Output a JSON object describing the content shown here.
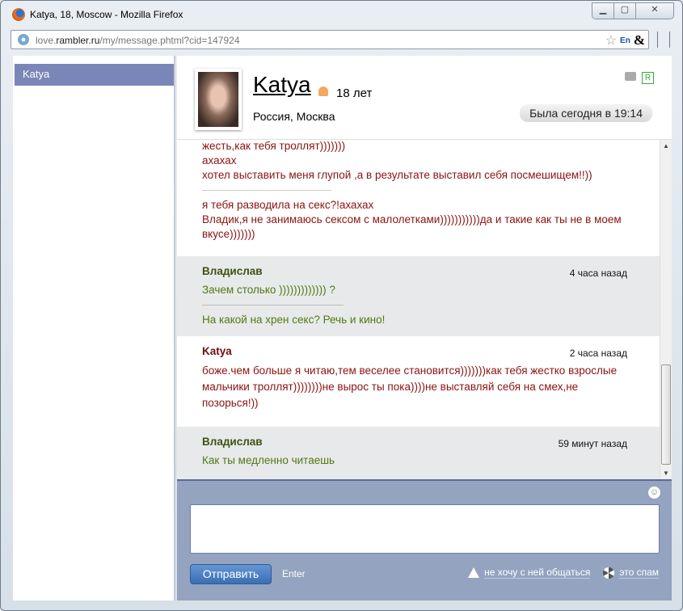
{
  "window": {
    "title": "Katya, 18, Moscow - Mozilla Firefox",
    "url_prefix": "love.",
    "url_domain": "rambler.ru",
    "url_path": "/my/message.phtml?cid=147924",
    "lang": "En"
  },
  "sidebar": {
    "items": [
      {
        "label": "Katya"
      }
    ]
  },
  "profile": {
    "name": "Katya",
    "age": "18 лет",
    "location": "Россия, Москва",
    "last_seen": "Была сегодня в 19:14",
    "badge": "R"
  },
  "messages": [
    {
      "author": "",
      "time": "",
      "parts": [
        [
          "жесть,как тебя троллят)))))))",
          "ахахах",
          "хотел выставить меня глупой ,а в результате выставил себя посмешищем!!))"
        ],
        [
          "я тебя разводила на секс?!ахахах",
          "Владик,я не занимаюсь сексом с малолетками)))))))))))да и такие как ты не в моем вкусе)))))))"
        ]
      ]
    },
    {
      "author": "Владислав",
      "time": "4 часа назад",
      "parts": [
        [
          "Зачем столько ))))))))))))) ?"
        ],
        [
          "На какой на хрен секс? Речь и кино!"
        ]
      ]
    },
    {
      "author": "Katya",
      "time": "2 часа назад",
      "parts": [
        [
          "боже.чем больше я читаю,тем веселее становится)))))))как тебя жестко взрослые мальчики троллят))))))))не вырос ты пока))))не выставляй себя на смех,не позорься!))"
        ]
      ]
    },
    {
      "author": "Владислав",
      "time": "59 минут назад",
      "parts": [
        [
          "Как ты медленно читаешь"
        ]
      ]
    }
  ],
  "composer": {
    "message_value": "",
    "send_label": "Отправить",
    "enter_hint": "Enter",
    "block_label": "не хочу с ней общаться",
    "spam_label": "это спам"
  }
}
